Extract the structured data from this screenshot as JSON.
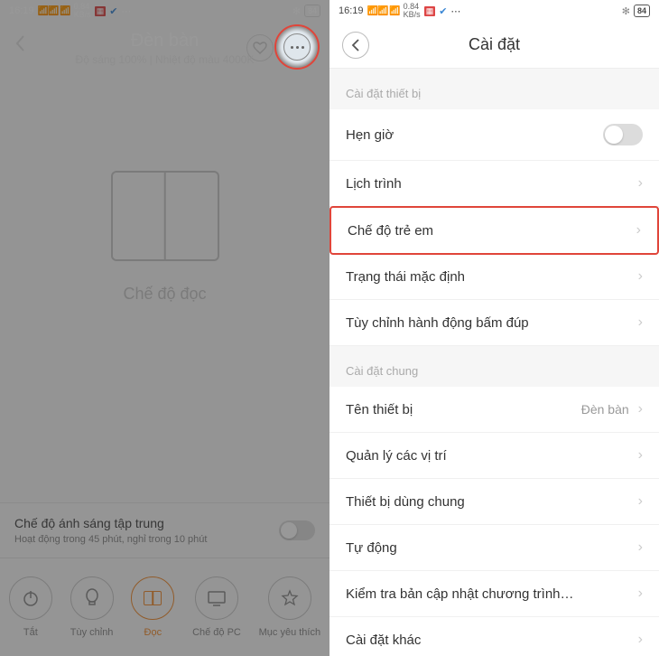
{
  "status": {
    "time": "16:19",
    "net_speed": "0.84",
    "net_unit": "KB/s",
    "battery": "84",
    "bt": "✻"
  },
  "left": {
    "title": "Đèn bàn",
    "subtitle": "Độ sáng 100% | Nhiệt độ màu 4000K",
    "mode_label": "Chế độ đọc",
    "focus_title": "Chế độ ánh sáng tập trung",
    "focus_sub": "Hoạt động trong 45 phút, nghỉ trong 10 phút",
    "tabs": [
      {
        "label": "Tắt"
      },
      {
        "label": "Tùy chỉnh"
      },
      {
        "label": "Đọc"
      },
      {
        "label": "Chế độ PC"
      },
      {
        "label": "Mục yêu thích"
      }
    ]
  },
  "right": {
    "title": "Cài đặt",
    "section1": "Cài đặt thiết bị",
    "section2": "Cài đặt chung",
    "rows1": [
      {
        "label": "Hẹn giờ",
        "type": "toggle"
      },
      {
        "label": "Lịch trình",
        "type": "nav"
      },
      {
        "label": "Chế độ trẻ em",
        "type": "nav",
        "highlight": true
      },
      {
        "label": "Trạng thái mặc định",
        "type": "nav"
      },
      {
        "label": "Tùy chỉnh hành động bấm đúp",
        "type": "nav"
      }
    ],
    "rows2": [
      {
        "label": "Tên thiết bị",
        "type": "nav",
        "value": "Đèn bàn"
      },
      {
        "label": "Quản lý các vị trí",
        "type": "nav"
      },
      {
        "label": "Thiết bị dùng chung",
        "type": "nav"
      },
      {
        "label": "Tự động",
        "type": "nav"
      },
      {
        "label": "Kiểm tra bản cập nhật chương trình…",
        "type": "nav"
      },
      {
        "label": "Cài đặt khác",
        "type": "nav"
      }
    ]
  }
}
